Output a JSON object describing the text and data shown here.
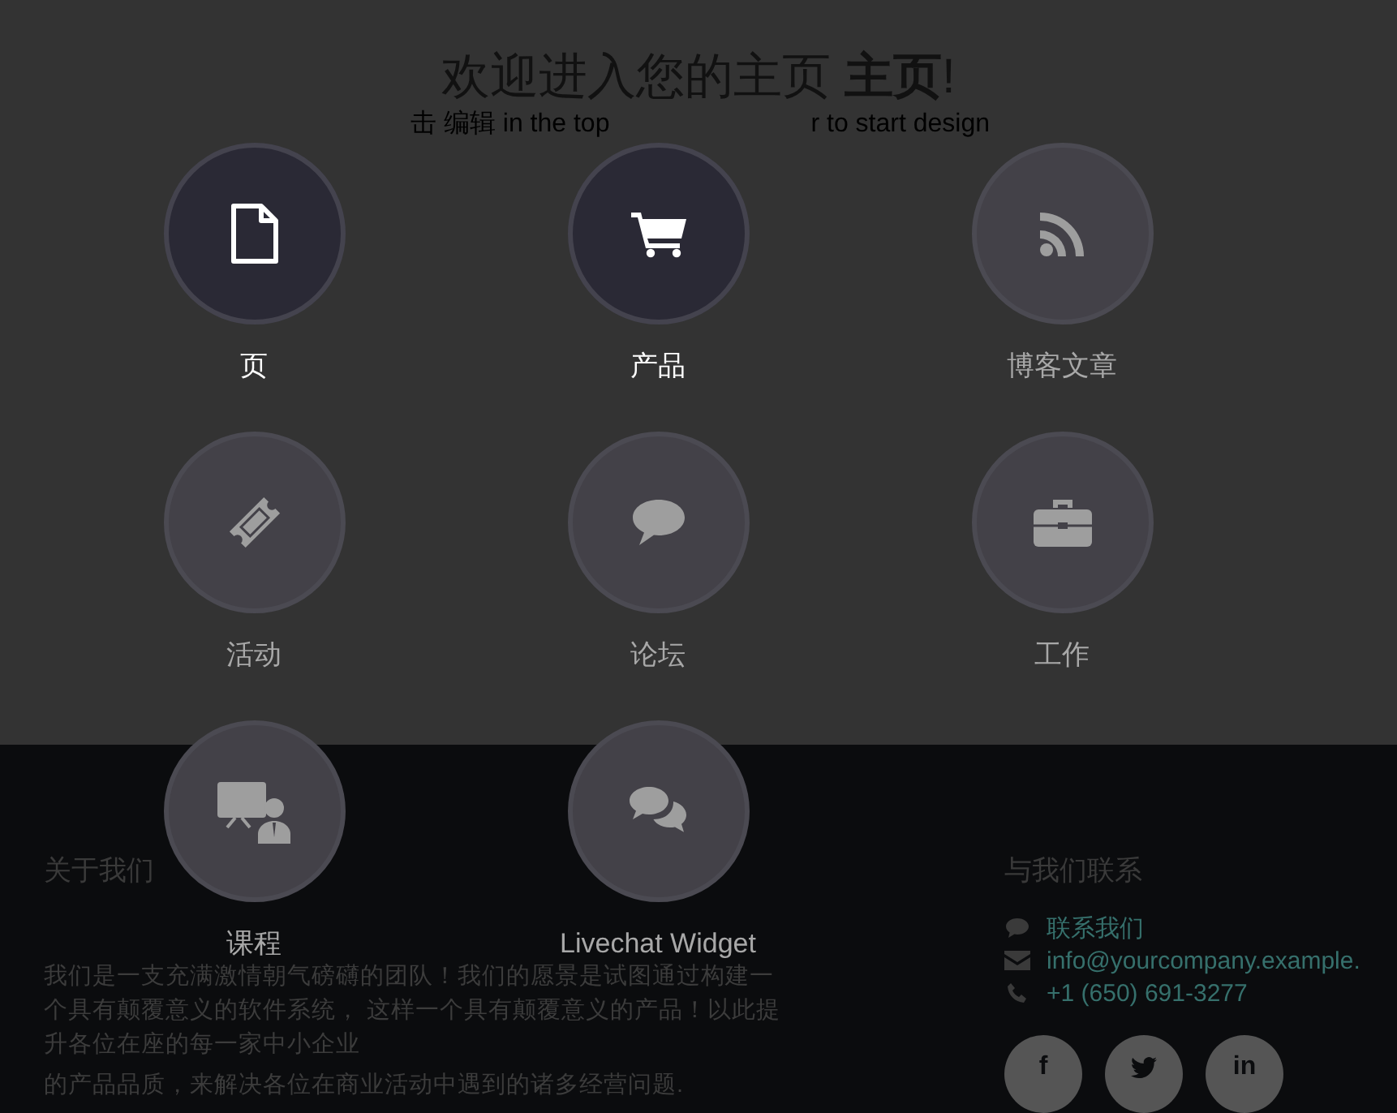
{
  "page": {
    "title": "欢迎进入您的主页 **主页**!",
    "subtitle_parts": [
      "击 编辑 in the top",
      "r to start design"
    ]
  },
  "new_content_menu": [
    {
      "kind": "page",
      "label": "页",
      "installed": true
    },
    {
      "kind": "product",
      "label": "产品",
      "installed": true
    },
    {
      "kind": "blog",
      "label": "博客文章",
      "installed": false
    },
    {
      "kind": "event",
      "label": "活动",
      "installed": false
    },
    {
      "kind": "forum",
      "label": "论坛",
      "installed": false
    },
    {
      "kind": "job",
      "label": "工作",
      "installed": false
    },
    {
      "kind": "course",
      "label": "课程",
      "installed": false
    },
    {
      "kind": "livechat",
      "label": "Livechat Widget",
      "installed": false
    }
  ],
  "footer": {
    "about": {
      "heading": "关于我们",
      "paragraphs": [
        "我们是一支充满激情朝气磅礴的团队！我们的愿景是试图通过构建一个具有颠覆意义的软件系统， 这样一个具有颠覆意义的产品！以此提升各位在座的每一家中小企业",
        "的产品品质，来解决各位在商业活动中遇到的诸多经营问题."
      ]
    },
    "contact": {
      "heading": "与我们联系",
      "items": [
        {
          "kind": "chat",
          "text": "联系我们"
        },
        {
          "kind": "email",
          "text": "info@yourcompany.example."
        },
        {
          "kind": "phone",
          "text": "+1 (650) 691-3277"
        }
      ],
      "social": [
        {
          "kind": "facebook",
          "label": "f"
        },
        {
          "kind": "twitter"
        },
        {
          "kind": "linkedin",
          "label": "in"
        }
      ]
    }
  }
}
